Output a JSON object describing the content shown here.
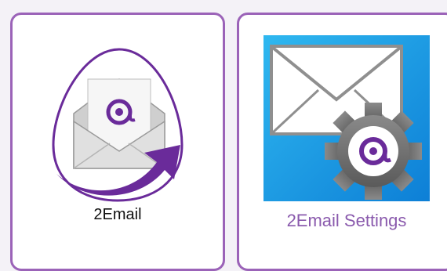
{
  "colors": {
    "tile_border": "#9b63b8",
    "accent_purple": "#6a2b9a",
    "settings_bg": "#1aa6e6",
    "settings_label": "#8a5aad"
  },
  "tiles": [
    {
      "label": "2Email",
      "icon": "email-send-icon"
    },
    {
      "label": "2Email Settings",
      "icon": "email-settings-icon"
    }
  ]
}
